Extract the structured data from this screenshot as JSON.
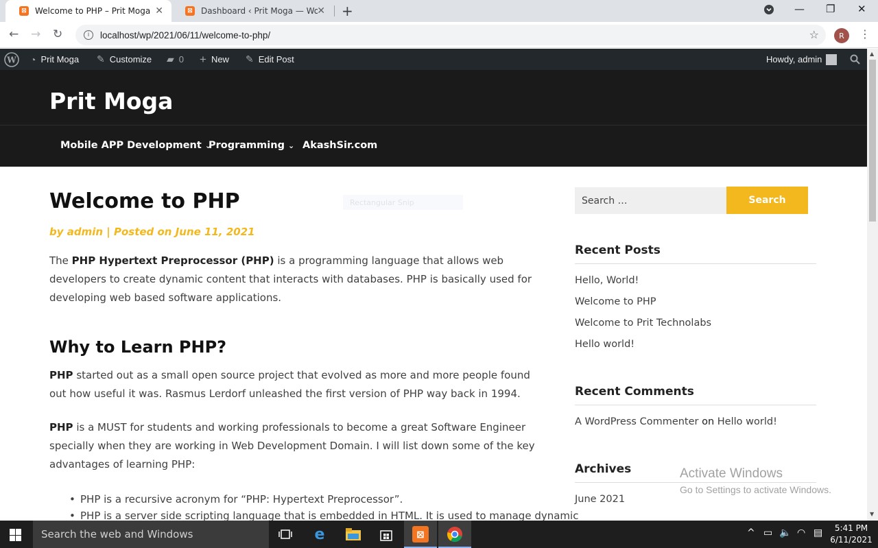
{
  "browser": {
    "tabs": [
      {
        "title": "Welcome to PHP – Prit Moga",
        "favicon": "xampp-icon"
      },
      {
        "title": "Dashboard ‹ Prit Moga — WordP",
        "favicon": "xampp-icon"
      }
    ],
    "url": "localhost/wp/2021/06/11/welcome-to-php/",
    "profile_initial": "R"
  },
  "adminbar": {
    "site_name": "Prit Moga",
    "customize": "Customize",
    "comments_count": "0",
    "new": "New",
    "edit_post": "Edit Post",
    "howdy": "Howdy, admin"
  },
  "site": {
    "title": "Prit Moga",
    "menu": [
      "Mobile APP Development",
      "Programming",
      "AkashSir.com"
    ]
  },
  "post": {
    "title": "Welcome to PHP",
    "meta": "by admin | Posted on June 11, 2021",
    "intro_bold": "PHP Hypertext Preprocessor (PHP)",
    "intro_pre": "The ",
    "intro_post": " is a programming language that allows web developers to create dynamic content that interacts with databases. PHP is basically used for developing web based software applications.",
    "h2": "Why to Learn PHP?",
    "p2_bold": "PHP",
    "p2_post": " started out as a small open source project that evolved as more and more people found out how useful it was. Rasmus Lerdorf unleashed the first version of PHP way back in 1994.",
    "p3_bold": "PHP",
    "p3_post": " is a MUST for students and working professionals to become a great Software Engineer specially when they are working in Web Development Domain. I will list down some of the key advantages of learning PHP:",
    "bullets": [
      "PHP is a recursive acronym for “PHP: Hypertext Preprocessor”.",
      "PHP is a server side scripting language that is embedded in HTML. It is used to manage dynamic"
    ],
    "snip_text": "Rectangular Snip"
  },
  "sidebar": {
    "search_placeholder": "Search …",
    "search_button": "Search",
    "recent_posts_title": "Recent Posts",
    "recent_posts": [
      "Hello, World!",
      "Welcome to PHP",
      "Welcome to Prit Technolabs",
      "Hello world!"
    ],
    "recent_comments_title": "Recent Comments",
    "comment_author": "A WordPress Commenter",
    "comment_on": "on",
    "comment_post": "Hello world!",
    "archives_title": "Archives",
    "archives": [
      "June 2021"
    ]
  },
  "watermark": {
    "line1": "Activate Windows",
    "line2": "Go to Settings to activate Windows."
  },
  "taskbar": {
    "search_placeholder": "Search the web and Windows",
    "time": "5:41 PM",
    "date": "6/11/2021"
  },
  "colors": {
    "accent": "#f3b81e",
    "header_bg": "#1a1a1a",
    "adminbar_bg": "#23282d"
  }
}
